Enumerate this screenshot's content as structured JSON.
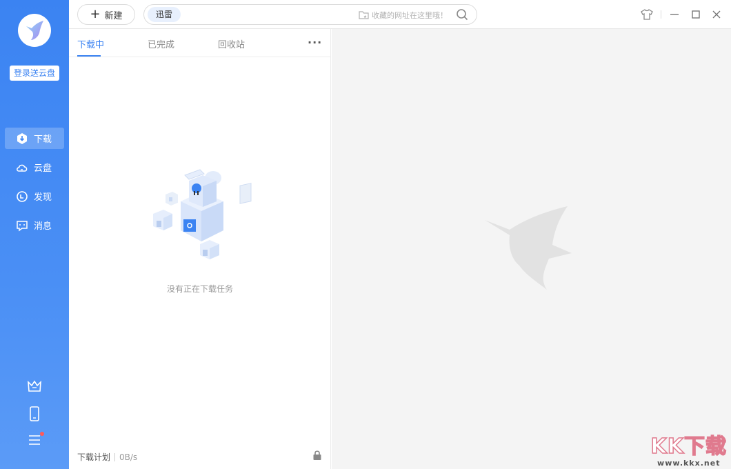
{
  "sidebar": {
    "login_label": "登录送云盘",
    "items": [
      {
        "label": "下载",
        "icon": "download-icon"
      },
      {
        "label": "云盘",
        "icon": "cloud-icon"
      },
      {
        "label": "发现",
        "icon": "discover-icon"
      },
      {
        "label": "消息",
        "icon": "message-icon"
      }
    ],
    "bottom_icons": [
      "crown-icon",
      "phone-icon",
      "menu-icon"
    ]
  },
  "topbar": {
    "new_label": "新建",
    "search_tag": "迅雷",
    "search_hint": "收藏的网址在这里哦！"
  },
  "panel": {
    "tabs": [
      "下载中",
      "已完成",
      "回收站"
    ],
    "more_label": "···",
    "empty_text": "没有正在下载任务",
    "footer_plan": "下载计划",
    "footer_speed": "0B/s"
  },
  "watermark": {
    "big": "KK下载",
    "small": "www.kkx.net"
  },
  "colors": {
    "accent": "#3b83f2",
    "sidebar_bottom": "#5b9bf7",
    "right_bg": "#f4f4f4"
  }
}
